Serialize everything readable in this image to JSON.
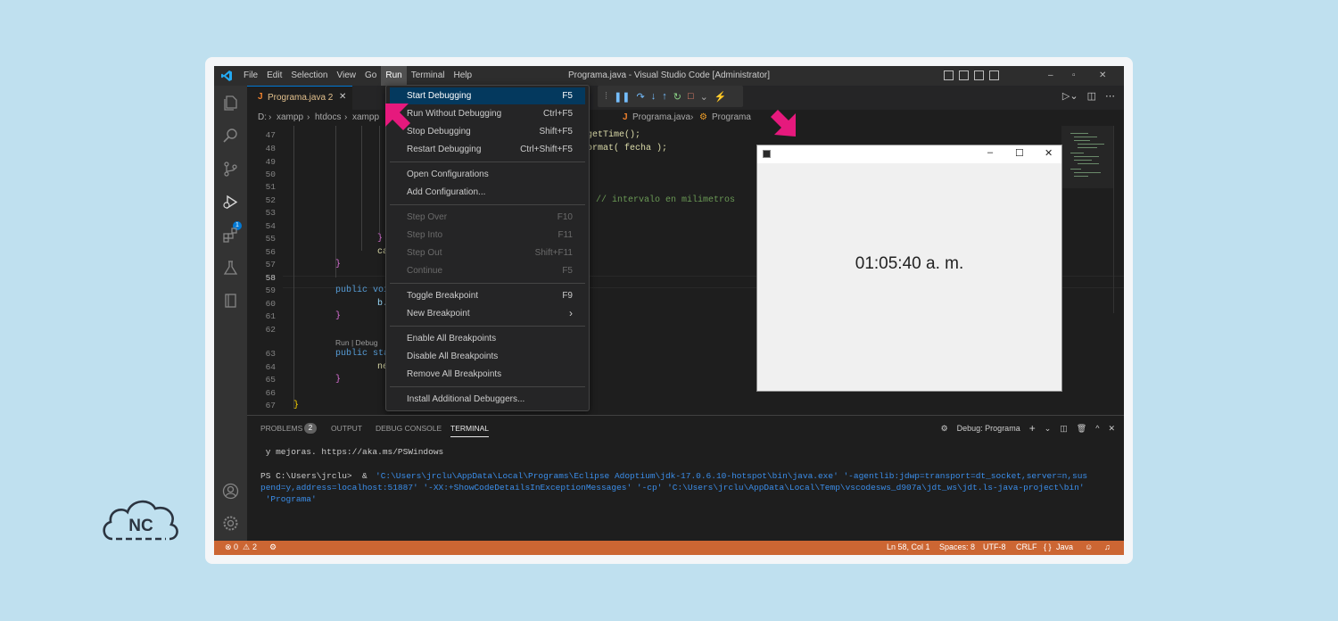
{
  "window_title": "Programa.java - Visual Studio Code [Administrator]",
  "menu_bar": [
    "File",
    "Edit",
    "Selection",
    "View",
    "Go",
    "Run",
    "Terminal",
    "Help"
  ],
  "active_menu": "Run",
  "tab": {
    "icon": "J",
    "label": "Programa.java 2",
    "close": "✕"
  },
  "breadcrumb": [
    "D:",
    "xampp",
    "htdocs",
    "xampp",
    "Programa.java",
    "Programa"
  ],
  "code": {
    "line_numbers": [
      "47",
      "48",
      "49",
      "50",
      "51",
      "52",
      "53",
      "54",
      "55",
      "56",
      "57",
      "58",
      "59",
      "60",
      "61",
      "62",
      "63",
      "64",
      "65",
      "66",
      "67"
    ],
    "codelens": "Run | Debug",
    "fragments": {
      "l47_tail": "getTime();",
      "l48_tail": "ormat( fecha );",
      "l52_comment": "// intervalo en milimetros",
      "l55": "}",
      "l56": "ca",
      "l57": "}",
      "l59_kw": "public voi",
      "l60": "b.",
      "l61": "}",
      "l63_kw": "public sta",
      "l64": "ne",
      "l65": "}",
      "l67": "}"
    }
  },
  "run_menu": {
    "items": [
      {
        "label": "Start Debugging",
        "shortcut": "F5"
      },
      {
        "label": "Run Without Debugging",
        "shortcut": "Ctrl+F5"
      },
      {
        "label": "Stop Debugging",
        "shortcut": "Shift+F5"
      },
      {
        "label": "Restart Debugging",
        "shortcut": "Ctrl+Shift+F5"
      },
      {
        "label": "Open Configurations",
        "shortcut": ""
      },
      {
        "label": "Add Configuration...",
        "shortcut": ""
      },
      {
        "label": "Step Over",
        "shortcut": "F10"
      },
      {
        "label": "Step Into",
        "shortcut": "F11"
      },
      {
        "label": "Step Out",
        "shortcut": "Shift+F11"
      },
      {
        "label": "Continue",
        "shortcut": "F5"
      },
      {
        "label": "Toggle Breakpoint",
        "shortcut": "F9"
      },
      {
        "label": "New Breakpoint",
        "shortcut": "›"
      },
      {
        "label": "Enable All Breakpoints",
        "shortcut": ""
      },
      {
        "label": "Disable All Breakpoints",
        "shortcut": ""
      },
      {
        "label": "Remove All Breakpoints",
        "shortcut": ""
      },
      {
        "label": "Install Additional Debuggers...",
        "shortcut": ""
      }
    ]
  },
  "panel": {
    "tabs": [
      "PROBLEMS",
      "OUTPUT",
      "DEBUG CONSOLE",
      "TERMINAL"
    ],
    "problems_count": "2",
    "active_tab": "TERMINAL",
    "debug_label": "Debug: Programa",
    "terminal_lines": [
      " y mejoras. https://aka.ms/PSWindows",
      "PS C:\\Users\\jrclu>  & ",
      "'C:\\Users\\jrclu\\AppData\\Local\\Programs\\Eclipse Adoptium\\jdk-17.0.6.10-hotspot\\bin\\java.exe' '-agentlib:jdwp=transport=dt_socket,server=n,sus",
      "pend=y,address=localhost:51887' '-XX:+ShowCodeDetailsInExceptionMessages' '-cp' 'C:\\Users\\jrclu\\AppData\\Local\\Temp\\vscodesws_d907a\\jdt_ws\\jdt.ls-java-project\\bin'",
      " 'Programa'"
    ]
  },
  "status_bar": {
    "errors": "0",
    "warnings": "2",
    "position": "Ln 58, Col 1",
    "spaces": "Spaces: 8",
    "encoding": "UTF-8",
    "eol": "CRLF",
    "language": "Java"
  },
  "java_window": {
    "clock": "01:05:40 a. m."
  },
  "logo_text": "NC",
  "colors": {
    "status_bar": "#cc6633",
    "selection": "#04395e",
    "arrow": "#e6197d",
    "accent": "#0078d4"
  }
}
